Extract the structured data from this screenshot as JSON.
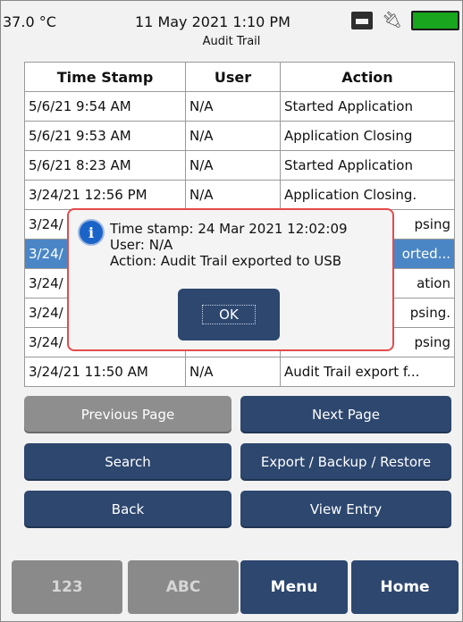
{
  "status_bar": {
    "temperature": "37.0 °C",
    "datetime": "11 May 2021 1:10 PM",
    "screen_title": "Audit Trail",
    "icons": [
      "storage-icon",
      "plug-icon",
      "battery-icon"
    ]
  },
  "table": {
    "headers": [
      "Time Stamp",
      "User",
      "Action"
    ],
    "rows": [
      {
        "time": "5/6/21 9:54 AM",
        "user": "N/A",
        "action": "Started Application"
      },
      {
        "time": "5/6/21 9:53 AM",
        "user": "N/A",
        "action": "Application Closing"
      },
      {
        "time": "5/6/21 8:23 AM",
        "user": "N/A",
        "action": "Started Application"
      },
      {
        "time": "3/24/21 12:56 PM",
        "user": "N/A",
        "action": "Application Closing."
      },
      {
        "time": "3/24/",
        "user": "",
        "action": "psing"
      },
      {
        "time": "3/24/",
        "user": "",
        "action": "orted..."
      },
      {
        "time": "3/24/",
        "user": "",
        "action": "ation"
      },
      {
        "time": "3/24/",
        "user": "",
        "action": "psing."
      },
      {
        "time": "3/24/",
        "user": "",
        "action": "psing"
      },
      {
        "time": "3/24/21 11:50 AM",
        "user": "N/A",
        "action": "Audit Trail export f..."
      }
    ],
    "selected_row": 5
  },
  "buttons": {
    "previous_page": "Previous Page",
    "next_page": "Next Page",
    "search": "Search",
    "export_backup_restore": "Export / Backup / Restore",
    "back": "Back",
    "view_entry": "View Entry"
  },
  "soft_keys": {
    "numeric": "123",
    "alpha": "ABC",
    "menu": "Menu",
    "home": "Home"
  },
  "dialog": {
    "line1": "Time stamp: 24 Mar 2021 12:02:09",
    "line2": "User: N/A",
    "line3": "Action: Audit Trail exported to USB",
    "ok_label": "OK"
  },
  "colors": {
    "navy_button": "#2d476f",
    "disabled_button": "#8e8e8e",
    "selected_row": "#4a86c6",
    "dialog_border": "#e44b4b",
    "battery": "#19a51e"
  }
}
